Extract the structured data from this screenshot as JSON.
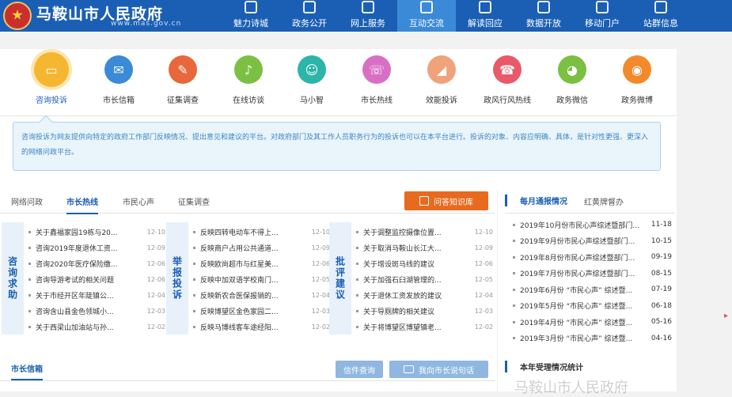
{
  "header": {
    "site_name": "马鞍山市人民政府",
    "site_url": "www.mas.gov.cn",
    "nav": [
      {
        "label": "魅力诗城",
        "active": false
      },
      {
        "label": "政务公开",
        "active": false
      },
      {
        "label": "网上服务",
        "active": false
      },
      {
        "label": "互动交流",
        "active": true
      },
      {
        "label": "解读回应",
        "active": false
      },
      {
        "label": "数据开放",
        "active": false
      },
      {
        "label": "移动门户",
        "active": false
      },
      {
        "label": "站群信息",
        "active": false
      }
    ]
  },
  "interaction_icons": [
    {
      "label": "咨询投诉",
      "icon": "chat-icon",
      "color": "#f5b731",
      "active": true
    },
    {
      "label": "市长信箱",
      "icon": "mail-icon",
      "color": "#3a8ad8",
      "active": false
    },
    {
      "label": "征集调查",
      "icon": "edit-icon",
      "color": "#e8683b",
      "active": false
    },
    {
      "label": "在线访谈",
      "icon": "microphone-icon",
      "color": "#7bc043",
      "active": false
    },
    {
      "label": "马小智",
      "icon": "robot-icon",
      "color": "#2cb5a8",
      "active": false
    },
    {
      "label": "市长热线",
      "icon": "phone-icon",
      "color": "#d86fc5",
      "active": false
    },
    {
      "label": "效能投诉",
      "icon": "megaphone-icon",
      "color": "#f0a27a",
      "active": false
    },
    {
      "label": "政风行风热线",
      "icon": "telephone-icon",
      "color": "#e85a6a",
      "active": false
    },
    {
      "label": "政务微信",
      "icon": "wechat-icon",
      "color": "#7bc043",
      "active": false
    },
    {
      "label": "政务微博",
      "icon": "weibo-icon",
      "color": "#f28a2c",
      "active": false
    }
  ],
  "notice": {
    "text": "咨询投诉为网友提供向特定的政府工作部门反映情况、提出意见和建议的平台。对政府部门及其工作人员职务行为的投诉也可以在本平台进行。投诉的对象、内容应明确、具体，是针对性更强、更深入的网络问政平台。"
  },
  "tabs": {
    "items": [
      {
        "label": "网络问政",
        "active": false
      },
      {
        "label": "市长热线",
        "active": true
      },
      {
        "label": "市民心声",
        "active": false
      },
      {
        "label": "征集调查",
        "active": false
      }
    ],
    "knowledge_button": "问答知识库"
  },
  "columns": [
    {
      "side": "咨询求助",
      "rows": [
        {
          "title": "关于鑫福家园19栋与20...",
          "date": "12-10"
        },
        {
          "title": "咨询2019年度退休工资...",
          "date": "12-09"
        },
        {
          "title": "咨询2020年医疗保险缴...",
          "date": "12-06"
        },
        {
          "title": "咨询导游考试的相关问题",
          "date": "12-06"
        },
        {
          "title": "关于市经开区年陡镇公...",
          "date": "12-04"
        },
        {
          "title": "咨询含山县金色领城小...",
          "date": "12-03"
        },
        {
          "title": "关于西梁山加油站与孙...",
          "date": "12-02"
        }
      ]
    },
    {
      "side": "举报投诉",
      "rows": [
        {
          "title": "反映四转电动车不得上...",
          "date": "12-10"
        },
        {
          "title": "反映商户占用公共通道...",
          "date": "12-09"
        },
        {
          "title": "反映欧尚超市与红星美...",
          "date": "12-06"
        },
        {
          "title": "反映中加双语学校南门...",
          "date": "12-05"
        },
        {
          "title": "反映新农合医保报销的...",
          "date": "12-04"
        },
        {
          "title": "反映博望区金色家园二...",
          "date": "12-03"
        },
        {
          "title": "反映马博线客车途经阳...",
          "date": "12-02"
        }
      ]
    },
    {
      "side": "批评建议",
      "rows": [
        {
          "title": "关于调整监控摄像位置...",
          "date": "12-10"
        },
        {
          "title": "关于取消马鞍山长江大...",
          "date": "12-09"
        },
        {
          "title": "关于增设斑马线的建议",
          "date": "12-06"
        },
        {
          "title": "关于加强石臼湖管理的...",
          "date": "12-05"
        },
        {
          "title": "关于退休工资发放的建议",
          "date": "12-04"
        },
        {
          "title": "关于导厕牌的相关建议",
          "date": "12-03"
        },
        {
          "title": "关于将博望区博望镇老...",
          "date": "12-02"
        }
      ]
    }
  ],
  "mailbox": {
    "title": "市长信箱",
    "query_button": "信件查询",
    "say_button": "我向市长说句话"
  },
  "right_panel": {
    "active_tab": "每月通报情况",
    "other_tab": "红黄牌督办",
    "rows": [
      {
        "title": "2019年10月份市民心声综述暨部门...",
        "date": "11-18"
      },
      {
        "title": "2019年9月份市民心声综述暨部门...",
        "date": "10-15"
      },
      {
        "title": "2019年8月份市民心声综述暨部门...",
        "date": "09-19"
      },
      {
        "title": "2019年7月份市民心声综述暨部门...",
        "date": "08-15"
      },
      {
        "title": "2019年6月份 “市民心声” 综述暨...",
        "date": "07-19"
      },
      {
        "title": "2019年5月份 “市民心声” 综述暨...",
        "date": "06-18"
      },
      {
        "title": "2019年4月份 “市民心声” 综述暨...",
        "date": "05-16"
      },
      {
        "title": "2019年3月份 “市民心声” 综述暨...",
        "date": "04-16"
      }
    ],
    "bottom_title": "本年受理情况统计"
  },
  "watermark": "马鞍山市人民政府"
}
